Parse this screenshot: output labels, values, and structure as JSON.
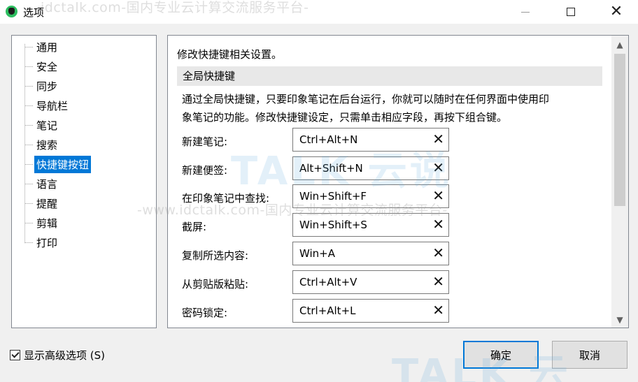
{
  "window": {
    "title": "选项"
  },
  "tree": {
    "items": [
      {
        "label": "通用",
        "selected": false
      },
      {
        "label": "安全",
        "selected": false
      },
      {
        "label": "同步",
        "selected": false
      },
      {
        "label": "导航栏",
        "selected": false
      },
      {
        "label": "笔记",
        "selected": false
      },
      {
        "label": "搜索",
        "selected": false
      },
      {
        "label": "快捷键按钮",
        "selected": true
      },
      {
        "label": "语言",
        "selected": false
      },
      {
        "label": "提醒",
        "selected": false
      },
      {
        "label": "剪辑",
        "selected": false
      },
      {
        "label": "打印",
        "selected": false
      }
    ]
  },
  "content": {
    "intro": "修改快捷键相关设置。",
    "section_header": "全局快捷键",
    "description_line1": "通过全局快捷键，只要印象笔记在后台运行，你就可以随时在任何界面中使用印",
    "description_line2": "象笔记的功能。修改快捷键设定，只需单击相应字段，再按下组合键。",
    "shortcuts": [
      {
        "label": "新建笔记:",
        "value": "Ctrl+Alt+N"
      },
      {
        "label": "新建便签:",
        "value": "Alt+Shift+N"
      },
      {
        "label": "在印象笔记中查找:",
        "value": "Win+Shift+F"
      },
      {
        "label": "截屏:",
        "value": "Win+Shift+S"
      },
      {
        "label": "复制所选内容:",
        "value": "Win+A"
      },
      {
        "label": "从剪贴版粘贴:",
        "value": "Ctrl+Alt+V"
      },
      {
        "label": "密码锁定:",
        "value": "Ctrl+Alt+L"
      }
    ]
  },
  "footer": {
    "advanced_label": "显示高级选项 (S)",
    "advanced_checked": true,
    "ok_label": "确定",
    "cancel_label": "取消"
  },
  "watermark": {
    "top": "idctalk.com-国内专业云计算交流服务平台-",
    "middle": "-www.idctalk.com-国内专业云计算交流服务平台-",
    "logo": "TALK 云说",
    "logo_bottom": "TALK 云"
  },
  "colors": {
    "accent": "#0078d7",
    "selection_bg": "#0078d7",
    "section_header_bg": "#e8e8e8"
  }
}
